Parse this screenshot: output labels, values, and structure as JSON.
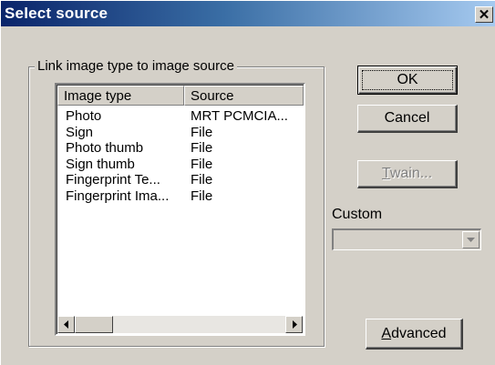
{
  "window": {
    "title": "Select source",
    "close_glyph": "✕"
  },
  "group": {
    "label": "Link image type to image source"
  },
  "list": {
    "columns": [
      "Image type",
      "Source"
    ],
    "rows": [
      {
        "type": "Photo",
        "source": "MRT PCMCIA..."
      },
      {
        "type": "Sign",
        "source": "File"
      },
      {
        "type": "Photo thumb",
        "source": "File"
      },
      {
        "type": "Sign thumb",
        "source": "File"
      },
      {
        "type": "Fingerprint Te...",
        "source": "File"
      },
      {
        "type": "Fingerprint Ima...",
        "source": "File"
      }
    ]
  },
  "buttons": {
    "ok": "OK",
    "cancel": "Cancel",
    "twain_mnemonic": "T",
    "twain_rest": "wain...",
    "advanced_mnemonic": "A",
    "advanced_rest": "dvanced"
  },
  "custom": {
    "label": "Custom",
    "value": ""
  },
  "icons": {
    "close": "close-icon",
    "scroll_left": "arrow-left-icon",
    "scroll_right": "arrow-right-icon",
    "dropdown": "chevron-down-icon"
  },
  "colors": {
    "title_gradient_start": "#0a246a",
    "title_gradient_end": "#a6caf0",
    "face": "#d4d0c8"
  }
}
